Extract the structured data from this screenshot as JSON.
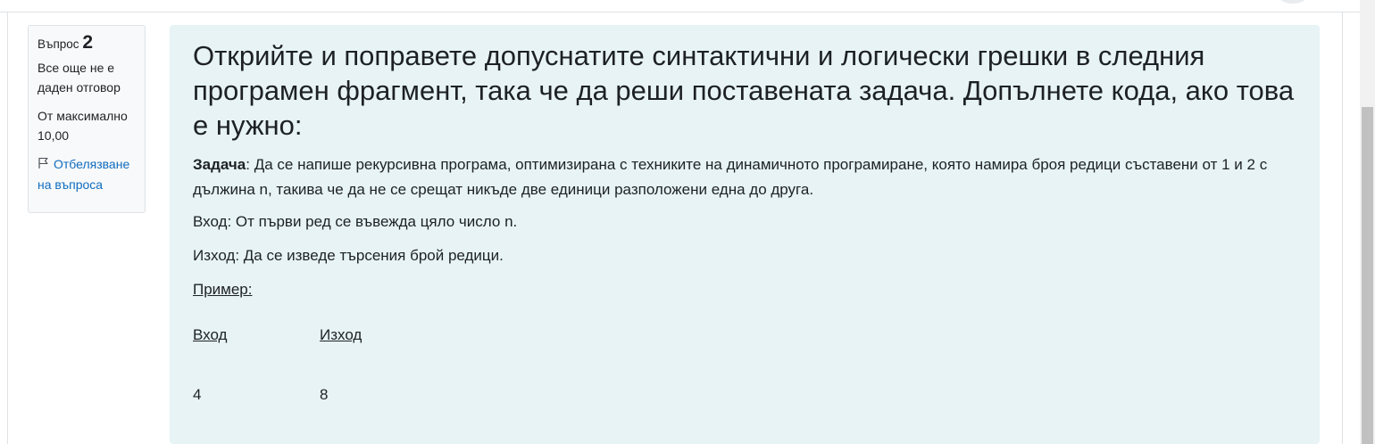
{
  "question_info": {
    "label": "Въпрос",
    "number": "2",
    "state": "Все още не е даден отговор",
    "grade": "От максимално 10,00",
    "flag_label": "Отбелязване на въпроса"
  },
  "question": {
    "title": "Открийте и поправете допуснатите синтактични и логически грешки в следния програмен фрагмент, така че да реши поставената задача. Допълнете кода, ако това е нужно:",
    "task_label": "Задача",
    "task_text": ": Да се напише рекурсивна програма, оптимизирана с техниките на динамичното програмиране, която намира броя редици съставени от 1 и 2 с дължина n, такива че да не се срещат никъде две единици разположени една до друга.",
    "input_text": "Вход: От първи ред се въвежда цяло число n.",
    "output_text": "Изход: Да се изведе търсения брой редици.",
    "example_label": "Пример:",
    "example": {
      "headers": [
        "Вход",
        "Изход"
      ],
      "values": [
        "4",
        "8"
      ]
    }
  }
}
